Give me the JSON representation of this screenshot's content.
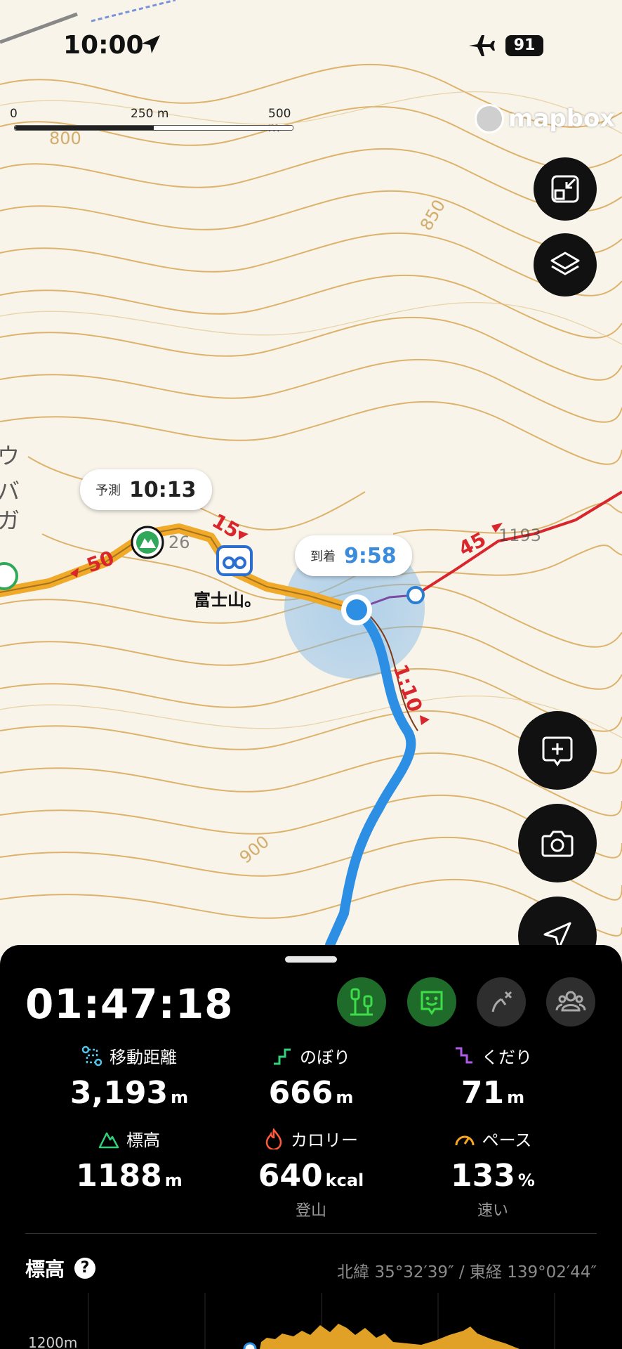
{
  "status": {
    "time": "10:00",
    "battery": "91"
  },
  "map": {
    "scale": {
      "zero": "0",
      "mid": "250 m",
      "end": "500 m"
    },
    "attribution": "mapbox",
    "forecast_bubble": {
      "label": "予測",
      "time": "10:13"
    },
    "arrival_bubble": {
      "label": "到着",
      "time": "9:58"
    },
    "place_label": "富士山。",
    "segment_times": [
      "15",
      "50",
      "45",
      "1:10"
    ],
    "contour_labels": [
      "800",
      "850",
      "900",
      "1193",
      "26"
    ],
    "edge_text": "ウバガ岩",
    "colors": {
      "route_orange": "#f0a928",
      "route_red": "#d9262c",
      "track_blue": "#2d8fe3",
      "contour": "#d7a24a"
    }
  },
  "buttons": {
    "collapse": "collapse-icon",
    "layers": "layers-icon",
    "add_note": "add-note-icon",
    "camera": "camera-icon",
    "locate": "locate-icon"
  },
  "sheet": {
    "elapsed": "01:47:18",
    "stats": [
      {
        "label": "移動距離",
        "value": "3,193",
        "unit": "m",
        "sub": ""
      },
      {
        "label": "のぼり",
        "value": "666",
        "unit": "m",
        "sub": ""
      },
      {
        "label": "くだり",
        "value": "71",
        "unit": "m",
        "sub": ""
      },
      {
        "label": "標高",
        "value": "1188",
        "unit": "m",
        "sub": ""
      },
      {
        "label": "カロリー",
        "value": "640",
        "unit": "kcal",
        "sub": "登山"
      },
      {
        "label": "ペース",
        "value": "133",
        "unit": "%",
        "sub": "速い"
      }
    ],
    "elevation_title": "標高",
    "help": "?",
    "coordinates": "北緯 35°32′39″ / 東経 139°02′44″",
    "profile_axis_label": "1200m"
  }
}
